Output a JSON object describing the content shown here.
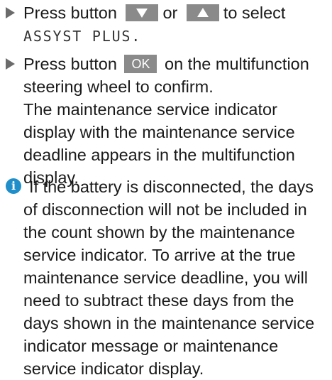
{
  "steps": [
    {
      "before": "Press button",
      "key_down_icon": "arrow-down-icon",
      "middle": "or",
      "key_up_icon": "arrow-up-icon",
      "after": "to select",
      "menu_item": "ASSYST PLUS."
    },
    {
      "before": "Press button",
      "ok_key": "OK",
      "after": "on the multifunction steering wheel to confirm.",
      "result": "The maintenance service indicator display with the maintenance service deadline appears in the multifunction display."
    }
  ],
  "note": {
    "icon": "info-icon",
    "text": "If the battery is disconnected, the days of disconnection will not be included in the count shown by the maintenance service indicator. To arrive at the true maintenance service deadline, you will need to subtract these days from the days shown in the maintenance service indicator message or maintenance service indicator display."
  },
  "colors": {
    "key_background": "#8a8a8a",
    "info_icon": "#1f8ec9",
    "bullet": "#6b6b6b",
    "text": "#1a1a1a"
  }
}
